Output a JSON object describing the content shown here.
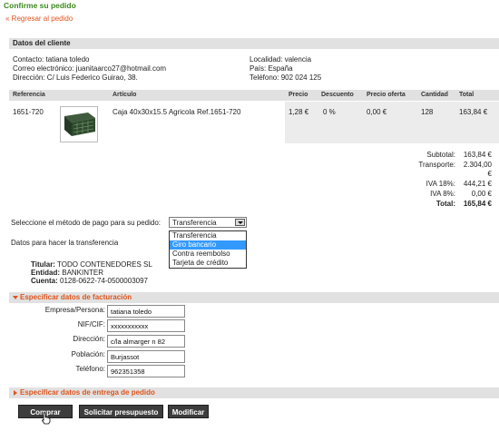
{
  "page": {
    "title": "Confirme su pedido",
    "back_link": "« Regresar al pedido"
  },
  "client": {
    "section_label": "Datos del cliente",
    "contact": "Contacto: tatiana toledo",
    "email": "Correo electrónico: juanitaarco27@hotmail.com",
    "address": "Dirección: C/ Luis Federico Guirao, 38.",
    "locality": "Localidad: valencia",
    "country": "País: España",
    "phone": "Teléfono: 902 024 125"
  },
  "table": {
    "headers": [
      "Referencia",
      "Artículo",
      "Precio",
      "Descuento",
      "Precio oferta",
      "Cantidad",
      "Total"
    ],
    "row": {
      "referencia": "1651-720",
      "articulo": "Caja 40x30x15.5 Agricola Ref.1651-720",
      "precio": "1,28 €",
      "descuento": "0 %",
      "precio_oferta": "0,00 €",
      "cantidad": "128",
      "total": "163,84 €"
    }
  },
  "totals": {
    "subtotal_label": "Subtotal:",
    "subtotal_value": "163,84 €",
    "transporte_label": "Transporte:",
    "transporte_value_1": "2.304,00",
    "transporte_value_2": "€",
    "iva18_label": "IVA 18%:",
    "iva18_value": "444,21 €",
    "iva8_label": "IVA 8%:",
    "iva8_value": "0,00 €",
    "total_label": "Total:",
    "total_value": "165,84 €"
  },
  "payment": {
    "label": "Seleccione el método de pago para su pedido:",
    "selected": "Transferencia",
    "options": [
      "Transferencia",
      "Giro bancario",
      "Contra reembolso",
      "Tarjeta de crédito"
    ],
    "highlighted_option": "Giro bancario",
    "transfer_heading": "Datos para hacer la transferencia",
    "titular_label": "Titular:",
    "titular_value": "TODO CONTENEDORES SL",
    "entidad_label": "Entidad:",
    "entidad_value": "BANKINTER",
    "cuenta_label": "Cuenta:",
    "cuenta_value": "0128-0622-74-0500003097"
  },
  "billing": {
    "section_label": "Especificar datos de facturación",
    "empresa_label": "Empresa/Persona:",
    "empresa_value": "tatiana toledo",
    "nif_label": "NIF/CIF:",
    "nif_value": "xxxxxxxxxxx",
    "direccion_label": "Dirección:",
    "direccion_value": "c/la almarger n 82",
    "poblacion_label": "Población:",
    "poblacion_value": "Burjassot",
    "telefono_label": "Teléfono:",
    "telefono_value": "962351358"
  },
  "delivery": {
    "section_label": "Especificar datos de entrega de pedido"
  },
  "buttons": {
    "comprar": "Comprar",
    "presupuesto": "Solicitar presupuesto",
    "modificar": "Modificar"
  },
  "colors": {
    "title_green": "#3c8a1e",
    "accent_orange": "#e0541c",
    "section_grey": "#e1e1e1",
    "button_dark": "#3d3d3d"
  }
}
